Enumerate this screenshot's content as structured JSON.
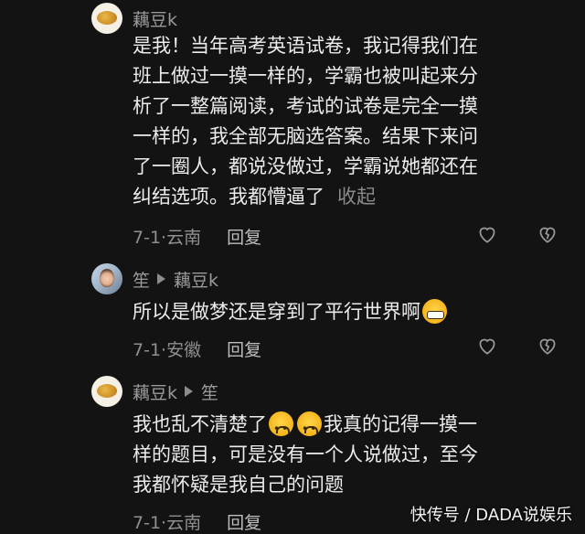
{
  "comments": [
    {
      "author": "藕豆k",
      "lines": [
        "是我！当年高考英语试卷，我记得我们在",
        "班上做过一摸一样的，学霸也被叫起来分",
        "析了一整篇阅读，考试的试卷是完全一摸",
        "一样的，我全部无脑选答案。结果下来问",
        "了一圈人，都说没做过，学霸说她都还在"
      ],
      "last_line": "纠结选项。我都懵逼了",
      "collapse_label": "收起",
      "date_location": "7-1·云南",
      "reply_label": "回复"
    },
    {
      "author": "笙",
      "reply_to": "藕豆k",
      "text": "所以是做梦还是穿到了平行世界啊",
      "emoji_icon": "grimace-emoji-icon",
      "date_location": "7-1·安徽",
      "reply_label": "回复"
    },
    {
      "author": "藕豆k",
      "reply_to": "笙",
      "text_before_emoji": "我也乱不清楚了",
      "emoji_icon": "crying-face-emoji-icon",
      "text_after_emoji": "我真的记得一摸一",
      "lines": [
        "样的题目，可是没有一个人说做过，至今",
        "我都怀疑是我自己的问题"
      ],
      "date_location": "7-1·云南",
      "reply_label": "回复"
    }
  ],
  "icons": {
    "like": "heart-outline-icon",
    "dislike": "broken-heart-icon"
  },
  "watermark": "快传号 / DADA说娱乐"
}
